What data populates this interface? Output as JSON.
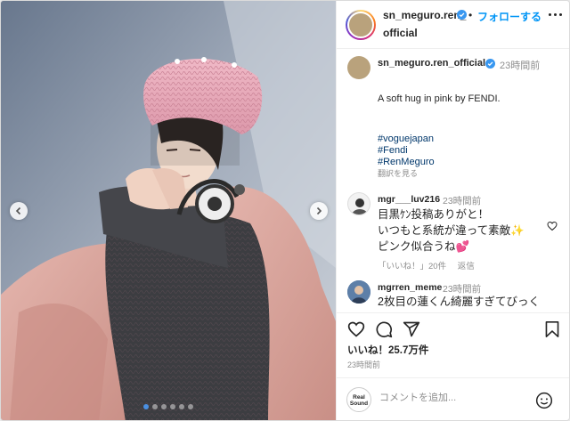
{
  "post": {
    "header": {
      "username_line1": "sn_meguro.ren_",
      "username_line2": "official",
      "separator": "•",
      "follow_label": "フォローする"
    },
    "caption": {
      "username": "sn_meguro.ren_official",
      "time": "23時間前",
      "text": "A soft hug in pink by FENDI.",
      "hashtags": [
        "#voguejapan",
        "#Fendi",
        "#RenMeguro"
      ],
      "translate_label": "翻訳を見る"
    },
    "comments": [
      {
        "username": "mgr___luv216",
        "time": "23時間前",
        "lines": [
          "目黒ｹﾝ投稿ありがと！",
          "いつもと系統が違って素敵✨",
          "ピンク似合うね💕"
        ],
        "likes_label": "「いいね！」20件",
        "reply_label": "返信"
      },
      {
        "username": "mgrren_meme",
        "time": "23時間前",
        "lines": [
          "2枚目の蓮くん綺麗すぎてびっく"
        ]
      }
    ],
    "likes": "いいね！25.7万件",
    "posted": "23時間前",
    "add_comment": {
      "avatar_text_line1": "Real",
      "avatar_text_line2": "Sound",
      "placeholder": "コメントを追加..."
    },
    "carousel": {
      "total": 6,
      "active": 0
    },
    "colors": {
      "accent": "#0095f6",
      "verified": "#3897f0",
      "hashtag": "#00376b",
      "coat": "#d9a79f",
      "hat": "#e8a8b8"
    },
    "icons": [
      "more-icon",
      "verified-icon",
      "heart-icon",
      "comment-icon",
      "share-icon",
      "bookmark-icon",
      "emoji-icon",
      "chevron-left-icon",
      "chevron-right-icon"
    ]
  }
}
